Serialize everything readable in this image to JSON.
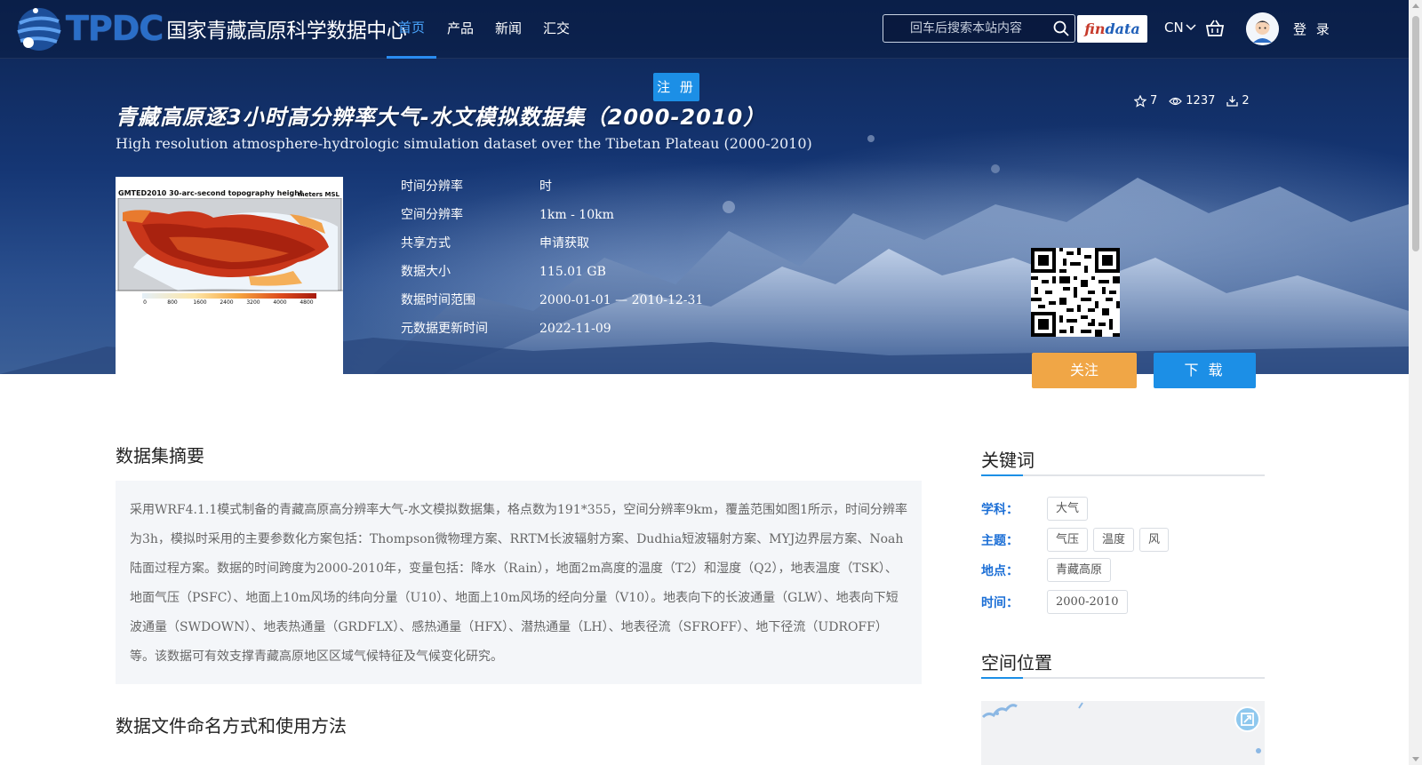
{
  "header": {
    "logo_abbr": "TPDC",
    "logo_name": "国家青藏高原科学数据中心",
    "nav": [
      {
        "label": "首页",
        "active": true
      },
      {
        "label": "产品",
        "active": false
      },
      {
        "label": "新闻",
        "active": false
      },
      {
        "label": "汇交",
        "active": false
      }
    ],
    "search_placeholder": "回车后搜索本站内容",
    "findata_part1": "fin",
    "findata_part2": "data",
    "lang": "CN",
    "login": "登 录",
    "register": "注 册"
  },
  "dataset": {
    "title_cn": "青藏高原逐3小时高分辨率大气-水文模拟数据集（2000-2010）",
    "title_en": "High resolution atmosphere-hydrologic simulation dataset over the Tibetan Plateau (2000-2010)",
    "stats": {
      "favorites": "7",
      "views": "1237",
      "downloads": "2"
    },
    "thumbnail": {
      "title": "GMTED2010 30-arc-second topography height",
      "unit": "meters MSL",
      "scale_ticks": [
        "0",
        "800",
        "1600",
        "2400",
        "3200",
        "4000",
        "4800"
      ]
    },
    "info": [
      {
        "label": "时间分辨率",
        "value": "时"
      },
      {
        "label": "空间分辨率",
        "value": "1km - 10km"
      },
      {
        "label": "共享方式",
        "value": "申请获取"
      },
      {
        "label": "数据大小",
        "value": "115.01 GB"
      },
      {
        "label": "数据时间范围",
        "value": "2000-01-01 — 2010-12-31"
      },
      {
        "label": "元数据更新时间",
        "value": "2022-11-09"
      }
    ],
    "follow_label": "关注",
    "download_label": "下 载"
  },
  "abstract": {
    "heading": "数据集摘要",
    "text": "采用WRF4.1.1模式制备的青藏高原高分辨率大气-水文模拟数据集，格点数为191*355，空间分辨率9km，覆盖范围如图1所示，时间分辨率为3h，模拟时采用的主要参数化方案包括：Thompson微物理方案、RRTM长波辐射方案、Dudhia短波辐射方案、MYJ边界层方案、Noah陆面过程方案。数据的时间跨度为2000-2010年，变量包括：降水（Rain），地面2m高度的温度（T2）和湿度（Q2），地表温度（TSK）、地面气压（PSFC）、地面上10m风场的纬向分量（U10）、地面上10m风场的经向分量（V10）。地表向下的长波通量（GLW）、地表向下短波通量（SWDOWN）、地表热通量（GRDFLX）、感热通量（HFX）、潜热通量（LH）、地表径流（SFROFF）、地下径流（UDROFF）等。该数据可有效支撑青藏高原地区区域气候特征及气候变化研究。"
  },
  "file_naming": {
    "heading": "数据文件命名方式和使用方法"
  },
  "keywords": {
    "heading": "关键词",
    "rows": [
      {
        "label": "学科：",
        "tags": [
          "大气"
        ]
      },
      {
        "label": "主题：",
        "tags": [
          "气压",
          "温度",
          "风"
        ]
      },
      {
        "label": "地点：",
        "tags": [
          "青藏高原"
        ]
      },
      {
        "label": "时间：",
        "tags": [
          "2000-2010"
        ]
      }
    ]
  },
  "spatial": {
    "heading": "空间位置"
  },
  "colors": {
    "accent": "#1c8fe6",
    "follow": "#f0a646",
    "keyword_label": "#1c6fd6"
  }
}
